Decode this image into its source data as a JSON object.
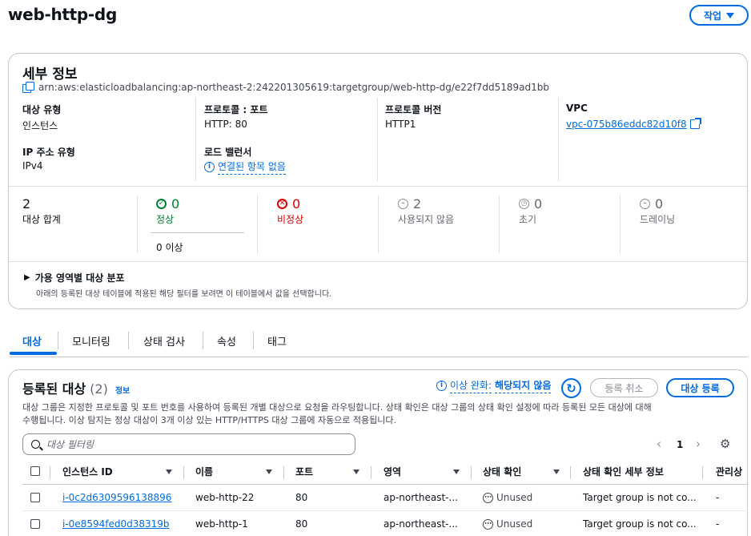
{
  "header": {
    "title": "web-http-dg",
    "action_label": "작업"
  },
  "details": {
    "title": "세부 정보",
    "arn": "arn:aws:elasticloadbalancing:ap-northeast-2:242201305619:targetgroup/web-http-dg/e22f7dd5189ad1bb",
    "fields": {
      "target_type_label": "대상 유형",
      "target_type_value": "인스턴스",
      "protocol_port_label": "프로토콜 : 포트",
      "protocol_port_value": "HTTP: 80",
      "protocol_version_label": "프로토콜 버전",
      "protocol_version_value": "HTTP1",
      "vpc_label": "VPC",
      "vpc_value": "vpc-075b86eddc82d10f8",
      "ip_type_label": "IP 주소 유형",
      "ip_type_value": "IPv4",
      "lb_label": "로드 밸런서",
      "lb_value": "연결된 항목 없음"
    },
    "counts": {
      "total_value": "2",
      "total_label": "대상 합계",
      "healthy_value": "0",
      "healthy_label": "정상",
      "healthy_sub": "0 이상",
      "unhealthy_value": "0",
      "unhealthy_label": "비정상",
      "unused_value": "2",
      "unused_label": "사용되지 않음",
      "initial_value": "0",
      "initial_label": "초기",
      "draining_value": "0",
      "draining_label": "드레이닝"
    },
    "az": {
      "title": "가용 영역별 대상 분포",
      "description": "아래의 등록된 대상 테이블에 적용된 해당 필터를 보려면 이 테이블에서 값을 선택합니다."
    }
  },
  "tabs": [
    "대상",
    "모니터링",
    "상태 검사",
    "속성",
    "태그"
  ],
  "registered": {
    "title": "등록된 대상",
    "count": "(2)",
    "info": "정보",
    "anomaly_label": "이상 완화:",
    "anomaly_value": "해당되지 않음",
    "deregister_label": "등록 취소",
    "register_label": "대상 등록",
    "desc_line1": "대상 그룹은 지정한 프로토콜 및 포트 번호를 사용하여 등록된 개별 대상으로 요청을 라우팅합니다. 상태 확인은 대상 그룹의 상태 확인 설정에 따라 등록된 모든 대상에 대해",
    "desc_line2": "수행됩니다. 이상 탐지는 정상 대상이 3개 이상 있는 HTTP/HTTPS 대상 그룹에 자동으로 적용됩니다.",
    "search_placeholder": "대상 필터링",
    "page_number": "1",
    "columns": [
      "인스턴스 ID",
      "이름",
      "포트",
      "영역",
      "상태 확인",
      "상태 확인 세부 정보",
      "관리상"
    ],
    "rows": [
      {
        "id": "i-0c2d6309596138896",
        "name": "web-http-22",
        "port": "80",
        "zone": "ap-northeast-...",
        "health": "Unused",
        "details": "Target group is not co...",
        "admin": "-"
      },
      {
        "id": "i-0e8594fed0d38319b",
        "name": "web-http-1",
        "port": "80",
        "zone": "ap-northeast-...",
        "health": "Unused",
        "details": "Target group is not co...",
        "admin": "-"
      }
    ]
  }
}
